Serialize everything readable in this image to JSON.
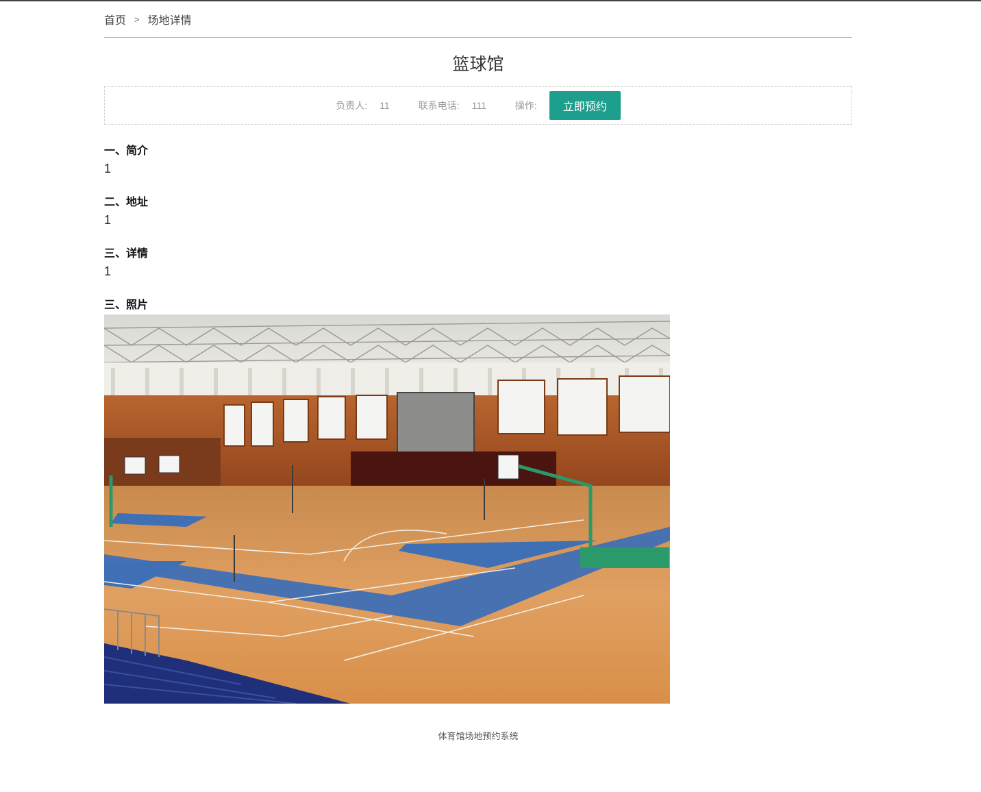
{
  "breadcrumb": {
    "home": "首页",
    "separator": ">",
    "current": "场地详情"
  },
  "venue": {
    "title": "篮球馆",
    "manager_label": "负责人:",
    "manager_value": "11",
    "phone_label": "联系电话:",
    "phone_value": "111",
    "action_label": "操作:",
    "book_button": "立即预约"
  },
  "sections": {
    "intro": {
      "heading": "一、简介",
      "body": "1"
    },
    "address": {
      "heading": "二、地址",
      "body": "1"
    },
    "details": {
      "heading": "三、详情",
      "body": "1"
    },
    "photo": {
      "heading": "三、照片"
    }
  },
  "footer": {
    "text": "体育馆场地预约系统"
  },
  "colors": {
    "accent": "#1e9e8c",
    "breadcrumb_border": "#d9a26b",
    "court_wood": "#d9944f",
    "court_blue": "#3f6fb5",
    "hoop_green": "#2a9a6a"
  }
}
